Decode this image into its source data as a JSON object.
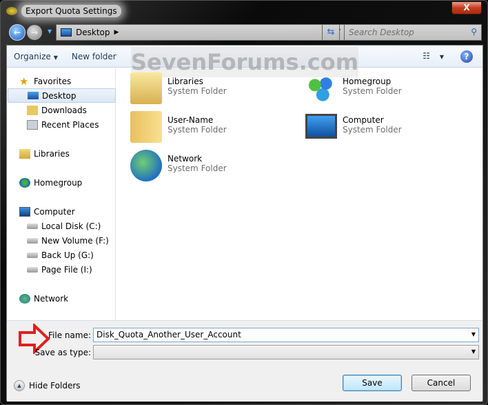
{
  "window": {
    "title": "Export Quota Settings",
    "close_label": "X"
  },
  "nav": {
    "address": "Desktop",
    "search_placeholder": "Search Desktop"
  },
  "toolbar": {
    "organize": "Organize",
    "new_folder": "New folder"
  },
  "watermark": "SevenForums.com",
  "sidebar": {
    "items": [
      {
        "label": "Favorites",
        "icon": "star-icon"
      },
      {
        "label": "Desktop",
        "icon": "desktop-icon",
        "selected": true
      },
      {
        "label": "Downloads",
        "icon": "downloads-folder-icon"
      },
      {
        "label": "Recent Places",
        "icon": "recent-places-icon"
      },
      {
        "label": "Libraries",
        "icon": "libraries-icon"
      },
      {
        "label": "Homegroup",
        "icon": "homegroup-icon"
      },
      {
        "label": "Computer",
        "icon": "computer-icon"
      },
      {
        "label": "Local Disk (C:)",
        "icon": "drive-icon"
      },
      {
        "label": "New Volume (F:)",
        "icon": "drive-icon"
      },
      {
        "label": "Back Up (G:)",
        "icon": "drive-icon"
      },
      {
        "label": "Page File (I:)",
        "icon": "drive-icon"
      },
      {
        "label": "Network",
        "icon": "network-icon"
      }
    ]
  },
  "main": {
    "items": [
      {
        "name": "Libraries",
        "type": "System Folder"
      },
      {
        "name": "Homegroup",
        "type": "System Folder"
      },
      {
        "name": "User-Name",
        "type": "System Folder"
      },
      {
        "name": "Computer",
        "type": "System Folder"
      },
      {
        "name": "Network",
        "type": "System Folder"
      }
    ]
  },
  "form": {
    "file_name_label": "File name:",
    "file_name_value": "Disk_Quota_Another_User_Account",
    "save_type_label": "Save as type:",
    "save_type_value": ""
  },
  "footer": {
    "hide_folders": "Hide Folders",
    "save": "Save",
    "cancel": "Cancel"
  },
  "colors": {
    "annotation_arrow": "#e02020",
    "accent": "#1e395b"
  }
}
